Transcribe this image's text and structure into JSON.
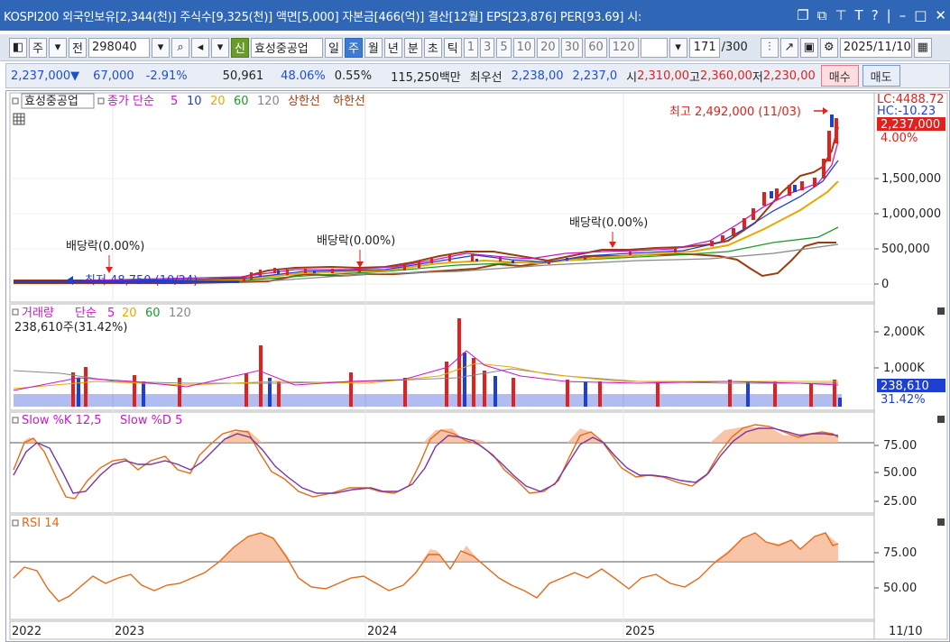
{
  "title_bar": {
    "text": "KOSPI200 외국인보유[2,344(천)] 주식수[9,325(천)] 액면[5,000] 자본금[466(억)] 결산[12월] EPS[23,876] PER[93.69] 시:"
  },
  "toolbar": {
    "code": "298040",
    "prev_label": "전",
    "main_label": "주",
    "new_badge": "신",
    "stock_name": "효성중공업",
    "periods": [
      "일",
      "주",
      "월",
      "년",
      "분",
      "초",
      "틱"
    ],
    "active_period": "주",
    "intervals": [
      "1",
      "3",
      "5",
      "10",
      "20",
      "30",
      "60",
      "120"
    ],
    "count": "171",
    "count_total": "/300",
    "date": "2025/11/10"
  },
  "quote": {
    "price": "2,237,000",
    "direction": "▼",
    "change": "67,000",
    "change_pct": "-2.91%",
    "volume": "50,961",
    "ratio": "48.06%",
    "turnover": "0.55%",
    "amount": "115,250백만",
    "best_label": "최우선",
    "best_bid": "2,238,00",
    "best_ask": "2,237,0",
    "open_label": "시",
    "open": "2,310,00",
    "high_label": "고",
    "high": "2,360,00",
    "low_label": "저",
    "low": "2,230,00",
    "buy_label": "매수",
    "sell_label": "매도"
  },
  "price_panel": {
    "stock_label": "효성중공업",
    "legend_price": "종가 단순",
    "ma": [
      {
        "label": "5",
        "color": "#c818c8"
      },
      {
        "label": "10",
        "color": "#1f3fd0"
      },
      {
        "label": "20",
        "color": "#e8a800"
      },
      {
        "label": "60",
        "color": "#1c9a2c"
      },
      {
        "label": "120",
        "color": "#888888"
      }
    ],
    "upper_label": "상한선",
    "lower_label": "하한선",
    "band_color": "#9b3c0e",
    "lc_label": "LC:4488.72",
    "hc_label": "HC:-10.23",
    "current_price": "2,237,000",
    "current_pct": "4.00%",
    "high_annotation": "최고 2,492,000 (11/03)",
    "low_annotation": "최저 48,750 (10/24)",
    "dividend_label": "배당락(0.00%)",
    "y_ticks": [
      "1,500,000",
      "1,000,000",
      "500,000",
      "0"
    ]
  },
  "volume_panel": {
    "title": "거래량",
    "ma_label": "단순",
    "ma": [
      "5",
      "20",
      "60",
      "120"
    ],
    "value_line": "238,610주(31.42%)",
    "current": "238,610",
    "current_pct": "31.42%",
    "y_ticks": [
      "2,000K",
      "1,000K"
    ]
  },
  "stoch_panel": {
    "title_k": "Slow %K 12,5",
    "title_d": "Slow %D 5",
    "y_ticks": [
      "75.00",
      "50.00",
      "25.00"
    ]
  },
  "rsi_panel": {
    "title": "RSI 14",
    "y_ticks": [
      "75.00",
      "50.00"
    ]
  },
  "x_axis": {
    "labels": [
      "2022",
      "2023",
      "2024",
      "2025"
    ],
    "right_date": "11/10"
  }
}
